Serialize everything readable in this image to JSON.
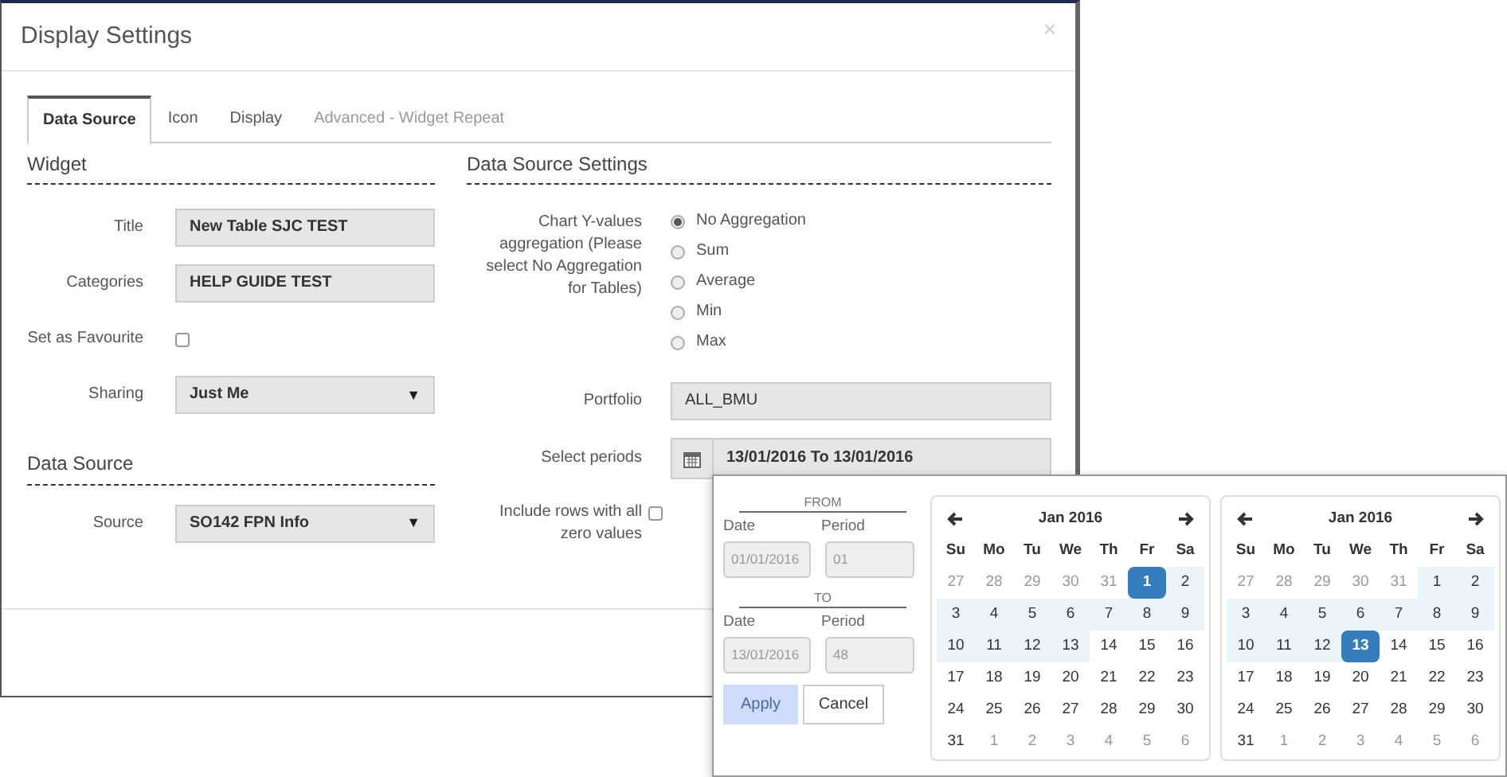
{
  "dialog": {
    "title": "Display Settings",
    "close": "×"
  },
  "tabs": [
    {
      "label": "Data Source",
      "selected": true,
      "disabled": false
    },
    {
      "label": "Icon",
      "selected": false,
      "disabled": false
    },
    {
      "label": "Display",
      "selected": false,
      "disabled": false
    },
    {
      "label": "Advanced - Widget Repeat",
      "selected": false,
      "disabled": true
    }
  ],
  "widget": {
    "heading": "Widget",
    "fields": [
      {
        "kind": "text",
        "label": "Title",
        "value": "New Table SJC TEST"
      },
      {
        "kind": "text",
        "label": "Categories",
        "value": "HELP GUIDE TEST"
      },
      {
        "kind": "checkbox",
        "label": "Set as Favourite",
        "checked": false
      },
      {
        "kind": "select",
        "label": "Sharing",
        "value": "Just Me",
        "caret": "▼"
      }
    ]
  },
  "data_source": {
    "heading": "Data Source",
    "fields": [
      {
        "kind": "select",
        "label": "Source",
        "value": "SO142 FPN Info",
        "caret": "▼"
      }
    ]
  },
  "settings": {
    "heading": "Data Source Settings",
    "aggregation": {
      "label": "Chart Y-values aggregation (Please select No Aggregation for Tables)",
      "options": [
        {
          "label": "No Aggregation",
          "selected": true
        },
        {
          "label": "Sum",
          "selected": false
        },
        {
          "label": "Average",
          "selected": false
        },
        {
          "label": "Min",
          "selected": false
        },
        {
          "label": "Max",
          "selected": false
        }
      ]
    },
    "portfolio": {
      "label": "Portfolio",
      "value": "ALL_BMU"
    },
    "periods": {
      "label": "Select periods",
      "value": "13/01/2016 To 13/01/2016"
    },
    "include_zero": {
      "label": "Include rows with all zero values",
      "checked": false
    }
  },
  "picker": {
    "ranges": [
      {
        "heading": "FROM",
        "date_label": "Date",
        "period_label": "Period",
        "date": "01/01/2016",
        "period": "01"
      },
      {
        "heading": "TO",
        "date_label": "Date",
        "period_label": "Period",
        "date": "13/01/2016",
        "period": "48"
      }
    ],
    "apply": "Apply",
    "cancel": "Cancel",
    "calendars": [
      {
        "month": "Jan 2016",
        "weekdays": [
          "Su",
          "Mo",
          "Tu",
          "We",
          "Th",
          "Fr",
          "Sa"
        ],
        "weeks": [
          [
            {
              "day": "27",
              "muted": true,
              "in_range": false,
              "selected": false
            },
            {
              "day": "28",
              "muted": true,
              "in_range": false,
              "selected": false
            },
            {
              "day": "29",
              "muted": true,
              "in_range": false,
              "selected": false
            },
            {
              "day": "30",
              "muted": true,
              "in_range": false,
              "selected": false
            },
            {
              "day": "31",
              "muted": true,
              "in_range": false,
              "selected": false
            },
            {
              "day": "1",
              "muted": false,
              "in_range": true,
              "selected": true
            },
            {
              "day": "2",
              "muted": false,
              "in_range": true,
              "selected": false
            }
          ],
          [
            {
              "day": "3",
              "muted": false,
              "in_range": true,
              "selected": false
            },
            {
              "day": "4",
              "muted": false,
              "in_range": true,
              "selected": false
            },
            {
              "day": "5",
              "muted": false,
              "in_range": true,
              "selected": false
            },
            {
              "day": "6",
              "muted": false,
              "in_range": true,
              "selected": false
            },
            {
              "day": "7",
              "muted": false,
              "in_range": true,
              "selected": false
            },
            {
              "day": "8",
              "muted": false,
              "in_range": true,
              "selected": false
            },
            {
              "day": "9",
              "muted": false,
              "in_range": true,
              "selected": false
            }
          ],
          [
            {
              "day": "10",
              "muted": false,
              "in_range": true,
              "selected": false
            },
            {
              "day": "11",
              "muted": false,
              "in_range": true,
              "selected": false
            },
            {
              "day": "12",
              "muted": false,
              "in_range": true,
              "selected": false
            },
            {
              "day": "13",
              "muted": false,
              "in_range": true,
              "selected": false
            },
            {
              "day": "14",
              "muted": false,
              "in_range": false,
              "selected": false
            },
            {
              "day": "15",
              "muted": false,
              "in_range": false,
              "selected": false
            },
            {
              "day": "16",
              "muted": false,
              "in_range": false,
              "selected": false
            }
          ],
          [
            {
              "day": "17",
              "muted": false,
              "in_range": false,
              "selected": false
            },
            {
              "day": "18",
              "muted": false,
              "in_range": false,
              "selected": false
            },
            {
              "day": "19",
              "muted": false,
              "in_range": false,
              "selected": false
            },
            {
              "day": "20",
              "muted": false,
              "in_range": false,
              "selected": false
            },
            {
              "day": "21",
              "muted": false,
              "in_range": false,
              "selected": false
            },
            {
              "day": "22",
              "muted": false,
              "in_range": false,
              "selected": false
            },
            {
              "day": "23",
              "muted": false,
              "in_range": false,
              "selected": false
            }
          ],
          [
            {
              "day": "24",
              "muted": false,
              "in_range": false,
              "selected": false
            },
            {
              "day": "25",
              "muted": false,
              "in_range": false,
              "selected": false
            },
            {
              "day": "26",
              "muted": false,
              "in_range": false,
              "selected": false
            },
            {
              "day": "27",
              "muted": false,
              "in_range": false,
              "selected": false
            },
            {
              "day": "28",
              "muted": false,
              "in_range": false,
              "selected": false
            },
            {
              "day": "29",
              "muted": false,
              "in_range": false,
              "selected": false
            },
            {
              "day": "30",
              "muted": false,
              "in_range": false,
              "selected": false
            }
          ],
          [
            {
              "day": "31",
              "muted": false,
              "in_range": false,
              "selected": false
            },
            {
              "day": "1",
              "muted": true,
              "in_range": false,
              "selected": false
            },
            {
              "day": "2",
              "muted": true,
              "in_range": false,
              "selected": false
            },
            {
              "day": "3",
              "muted": true,
              "in_range": false,
              "selected": false
            },
            {
              "day": "4",
              "muted": true,
              "in_range": false,
              "selected": false
            },
            {
              "day": "5",
              "muted": true,
              "in_range": false,
              "selected": false
            },
            {
              "day": "6",
              "muted": true,
              "in_range": false,
              "selected": false
            }
          ]
        ]
      },
      {
        "month": "Jan 2016",
        "weekdays": [
          "Su",
          "Mo",
          "Tu",
          "We",
          "Th",
          "Fr",
          "Sa"
        ],
        "weeks": [
          [
            {
              "day": "27",
              "muted": true,
              "in_range": false,
              "selected": false
            },
            {
              "day": "28",
              "muted": true,
              "in_range": false,
              "selected": false
            },
            {
              "day": "29",
              "muted": true,
              "in_range": false,
              "selected": false
            },
            {
              "day": "30",
              "muted": true,
              "in_range": false,
              "selected": false
            },
            {
              "day": "31",
              "muted": true,
              "in_range": false,
              "selected": false
            },
            {
              "day": "1",
              "muted": false,
              "in_range": true,
              "selected": false
            },
            {
              "day": "2",
              "muted": false,
              "in_range": true,
              "selected": false
            }
          ],
          [
            {
              "day": "3",
              "muted": false,
              "in_range": true,
              "selected": false
            },
            {
              "day": "4",
              "muted": false,
              "in_range": true,
              "selected": false
            },
            {
              "day": "5",
              "muted": false,
              "in_range": true,
              "selected": false
            },
            {
              "day": "6",
              "muted": false,
              "in_range": true,
              "selected": false
            },
            {
              "day": "7",
              "muted": false,
              "in_range": true,
              "selected": false
            },
            {
              "day": "8",
              "muted": false,
              "in_range": true,
              "selected": false
            },
            {
              "day": "9",
              "muted": false,
              "in_range": true,
              "selected": false
            }
          ],
          [
            {
              "day": "10",
              "muted": false,
              "in_range": true,
              "selected": false
            },
            {
              "day": "11",
              "muted": false,
              "in_range": true,
              "selected": false
            },
            {
              "day": "12",
              "muted": false,
              "in_range": true,
              "selected": false
            },
            {
              "day": "13",
              "muted": false,
              "in_range": true,
              "selected": true
            },
            {
              "day": "14",
              "muted": false,
              "in_range": false,
              "selected": false
            },
            {
              "day": "15",
              "muted": false,
              "in_range": false,
              "selected": false
            },
            {
              "day": "16",
              "muted": false,
              "in_range": false,
              "selected": false
            }
          ],
          [
            {
              "day": "17",
              "muted": false,
              "in_range": false,
              "selected": false
            },
            {
              "day": "18",
              "muted": false,
              "in_range": false,
              "selected": false
            },
            {
              "day": "19",
              "muted": false,
              "in_range": false,
              "selected": false
            },
            {
              "day": "20",
              "muted": false,
              "in_range": false,
              "selected": false
            },
            {
              "day": "21",
              "muted": false,
              "in_range": false,
              "selected": false
            },
            {
              "day": "22",
              "muted": false,
              "in_range": false,
              "selected": false
            },
            {
              "day": "23",
              "muted": false,
              "in_range": false,
              "selected": false
            }
          ],
          [
            {
              "day": "24",
              "muted": false,
              "in_range": false,
              "selected": false
            },
            {
              "day": "25",
              "muted": false,
              "in_range": false,
              "selected": false
            },
            {
              "day": "26",
              "muted": false,
              "in_range": false,
              "selected": false
            },
            {
              "day": "27",
              "muted": false,
              "in_range": false,
              "selected": false
            },
            {
              "day": "28",
              "muted": false,
              "in_range": false,
              "selected": false
            },
            {
              "day": "29",
              "muted": false,
              "in_range": false,
              "selected": false
            },
            {
              "day": "30",
              "muted": false,
              "in_range": false,
              "selected": false
            }
          ],
          [
            {
              "day": "31",
              "muted": false,
              "in_range": false,
              "selected": false
            },
            {
              "day": "1",
              "muted": true,
              "in_range": false,
              "selected": false
            },
            {
              "day": "2",
              "muted": true,
              "in_range": false,
              "selected": false
            },
            {
              "day": "3",
              "muted": true,
              "in_range": false,
              "selected": false
            },
            {
              "day": "4",
              "muted": true,
              "in_range": false,
              "selected": false
            },
            {
              "day": "5",
              "muted": true,
              "in_range": false,
              "selected": false
            },
            {
              "day": "6",
              "muted": true,
              "in_range": false,
              "selected": false
            }
          ]
        ]
      }
    ]
  }
}
